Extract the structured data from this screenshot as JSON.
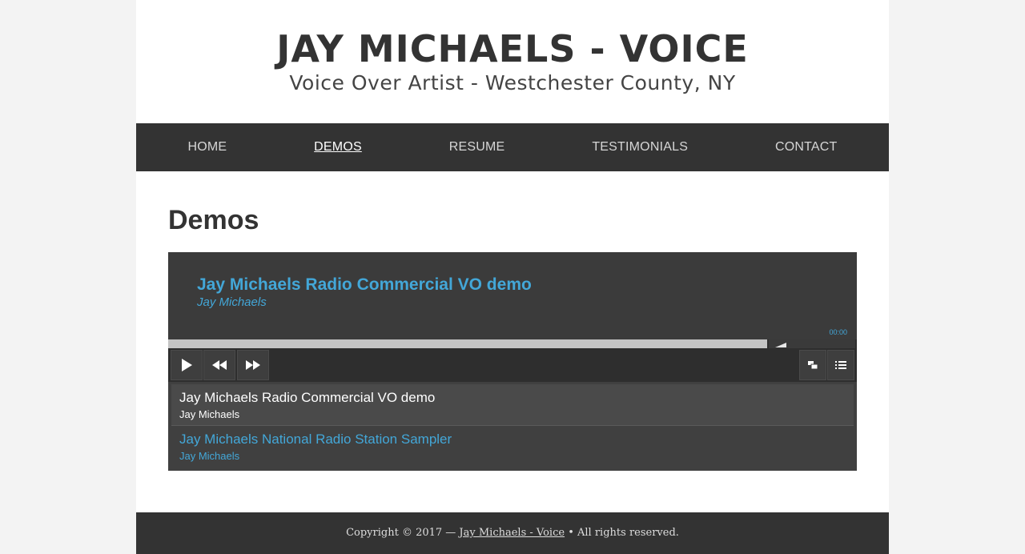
{
  "site": {
    "title": "JAY MICHAELS - VOICE",
    "tagline": "Voice Over Artist - Westchester County, NY"
  },
  "nav": {
    "items": [
      {
        "label": "HOME"
      },
      {
        "label": "DEMOS",
        "active": true
      },
      {
        "label": "RESUME"
      },
      {
        "label": "TESTIMONIALS"
      },
      {
        "label": "CONTACT"
      }
    ]
  },
  "main": {
    "heading": "Demos"
  },
  "player": {
    "now_playing": {
      "title": "Jay Michaels Radio Commercial VO demo",
      "artist": "Jay Michaels"
    },
    "time": "00:00",
    "playlist": [
      {
        "title": "Jay Michaels Radio Commercial VO demo",
        "artist": "Jay Michaels",
        "current": true
      },
      {
        "title": "Jay Michaels National Radio Station Sampler",
        "artist": "Jay Michaels",
        "current": false
      }
    ],
    "icons": {
      "play": "play-icon",
      "rewind": "rewind-icon",
      "forward": "fast-forward-icon",
      "popout": "popout-icon",
      "playlist": "playlist-icon"
    }
  },
  "footer": {
    "prefix": "Copyright © 2017 — ",
    "link": "Jay Michaels - Voice",
    "suffix": " • All rights reserved."
  },
  "colors": {
    "accent": "#43a7d8",
    "nav_bg": "#333333",
    "player_bg": "#404040"
  }
}
